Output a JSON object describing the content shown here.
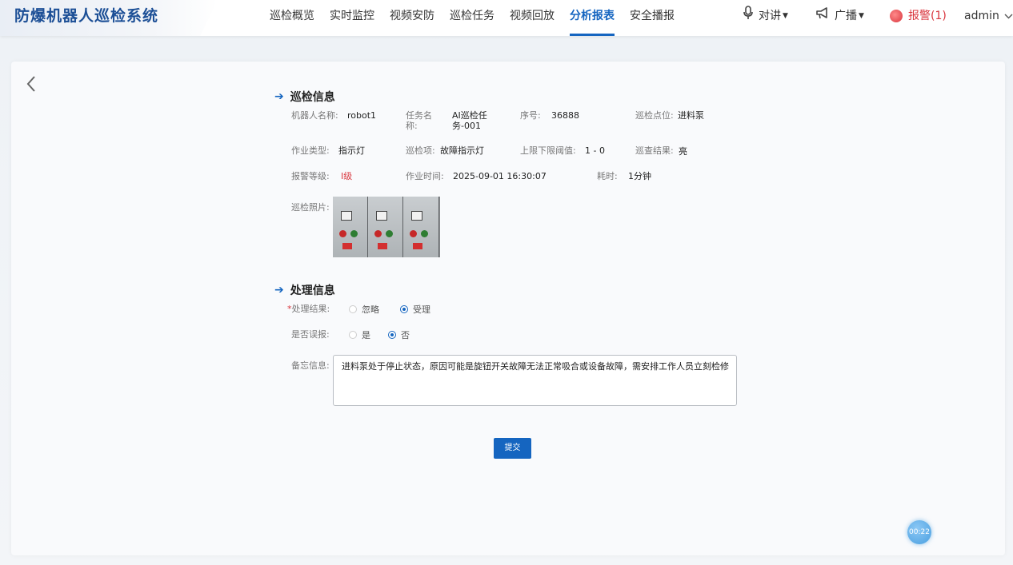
{
  "app": {
    "title": "防爆机器人巡检系统"
  },
  "nav": [
    {
      "label": "巡检概览"
    },
    {
      "label": "实时监控"
    },
    {
      "label": "视频安防"
    },
    {
      "label": "巡检任务"
    },
    {
      "label": "视频回放"
    },
    {
      "label": "分析报表",
      "active": true
    },
    {
      "label": "安全播报"
    }
  ],
  "header_tools": {
    "intercom": {
      "label": "对讲",
      "icon": "microphone-icon"
    },
    "broadcast": {
      "label": "广播",
      "icon": "megaphone-icon"
    },
    "alarm": {
      "label": "报警(1)",
      "icon": "alarm-icon",
      "color": "#d9363e"
    },
    "user": {
      "label": "admin",
      "icon": "chevron-down-icon"
    }
  },
  "inspection": {
    "section_title": "巡检信息",
    "robot_name": {
      "label": "机器人名称:",
      "value": "robot1"
    },
    "task_name": {
      "label_line1": "任务名",
      "label_line2": "称:",
      "value_line1": "AI巡检任",
      "value_line2": "务-001"
    },
    "serial": {
      "label": "序号:",
      "value": "36888"
    },
    "point": {
      "label": "巡检点位:",
      "value": "进料泵"
    },
    "job_type": {
      "label": "作业类型:",
      "value": "指示灯"
    },
    "item": {
      "label": "巡检项:",
      "value": "故障指示灯"
    },
    "threshold": {
      "label": "上限下限阈值:",
      "value": "1 - 0"
    },
    "result": {
      "label": "巡查结果:",
      "value": "亮"
    },
    "alarm_level": {
      "label": "报警等级:",
      "value": "Ⅰ级"
    },
    "job_time": {
      "label": "作业时间:",
      "value": "2025-09-01 16:30:07"
    },
    "duration": {
      "label": "耗时:",
      "value": "1分钟"
    },
    "photo": {
      "label": "巡检照片:"
    }
  },
  "handling": {
    "section_title": "处理信息",
    "result": {
      "label": "处理结果:",
      "required_mark": "*",
      "options": [
        "忽略",
        "受理"
      ],
      "selected": "受理"
    },
    "false_alarm": {
      "label": "是否误报:",
      "options": [
        "是",
        "否"
      ],
      "selected": "否"
    },
    "memo": {
      "label": "备忘信息:",
      "value": "进料泵处于停止状态，原因可能是旋钮开关故障无法正常吸合或设备故障，需安排工作人员立刻检修"
    },
    "submit_label": "提交"
  },
  "timer_badge": "00:22",
  "accent_color": "#1565c0"
}
